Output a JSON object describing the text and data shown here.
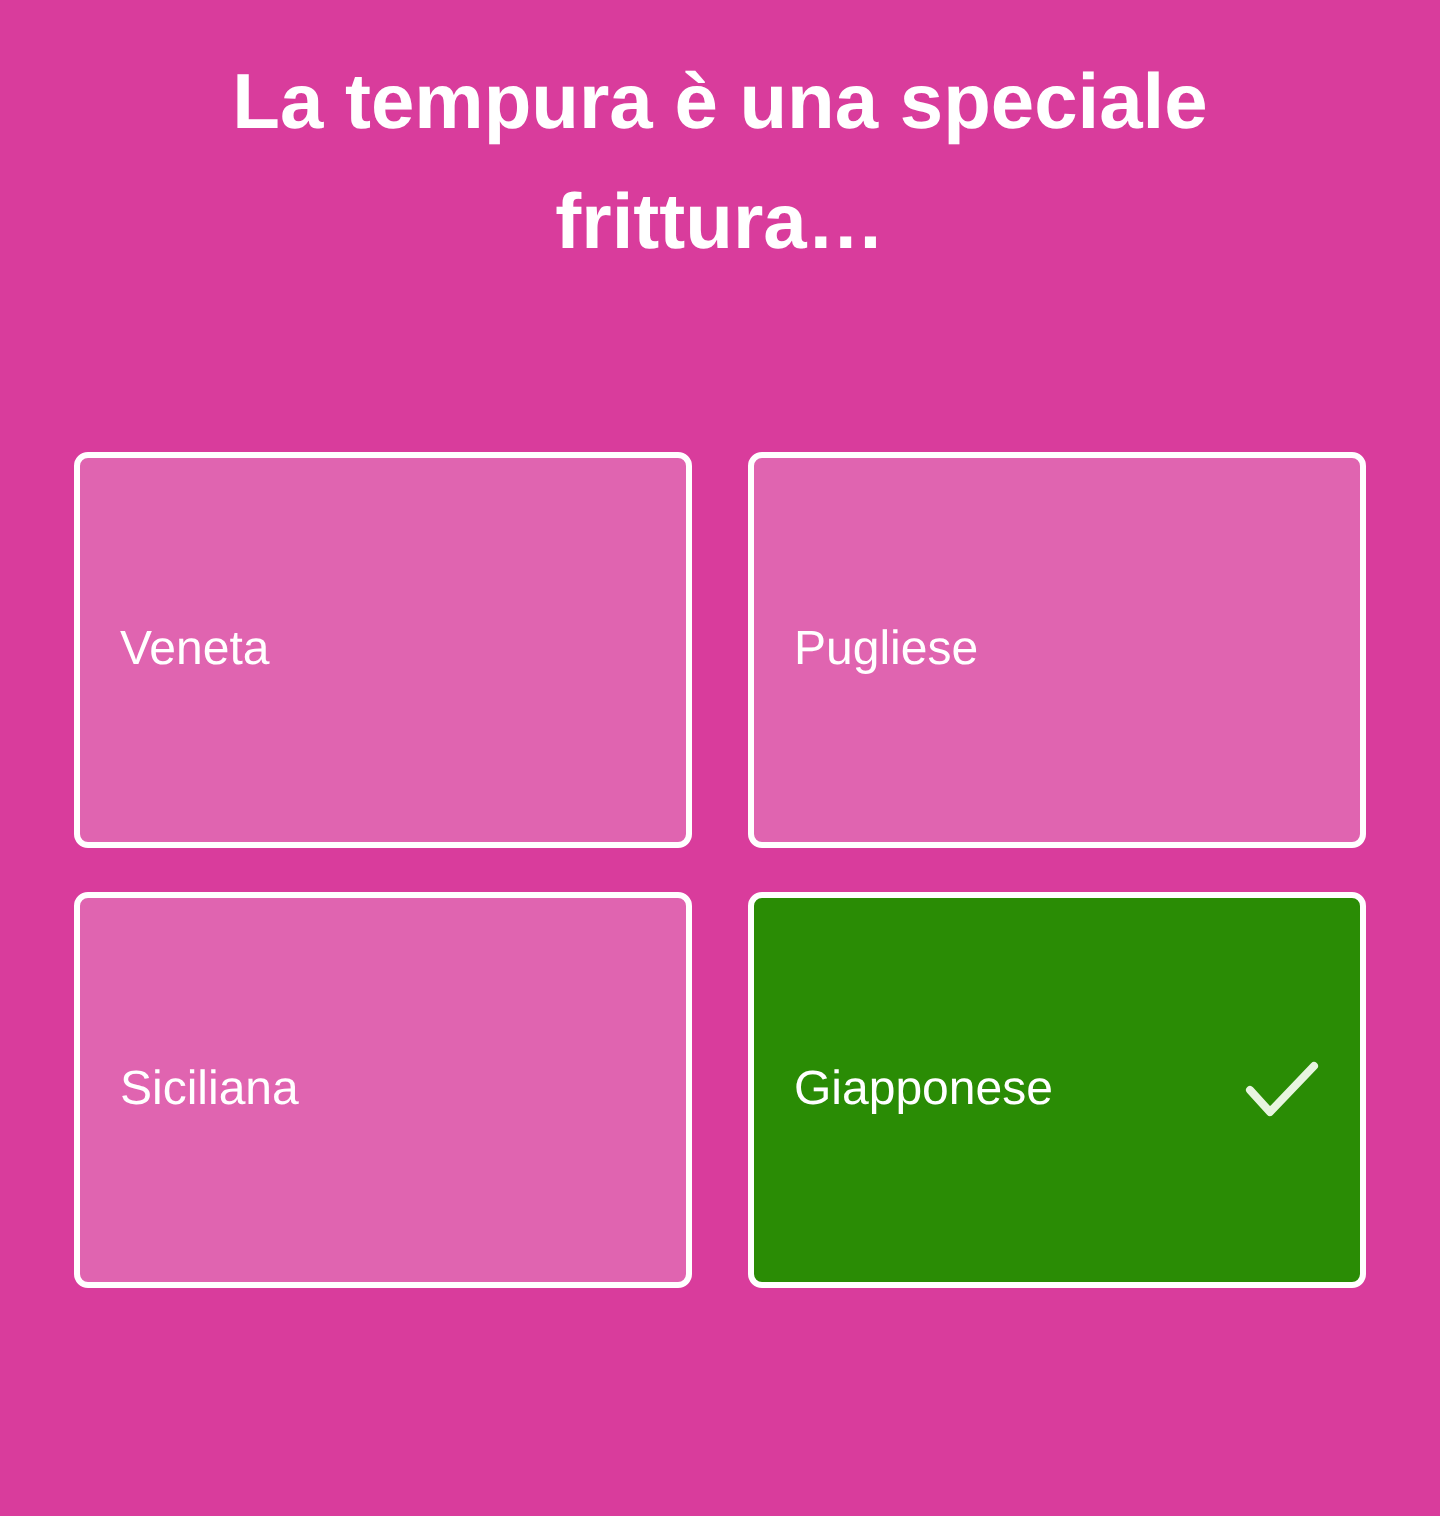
{
  "question": "La tempura è una speciale frittura…",
  "answers": [
    {
      "label": "Veneta",
      "correct": false
    },
    {
      "label": "Pugliese",
      "correct": false
    },
    {
      "label": "Siciliana",
      "correct": false
    },
    {
      "label": "Giapponese",
      "correct": true
    }
  ]
}
